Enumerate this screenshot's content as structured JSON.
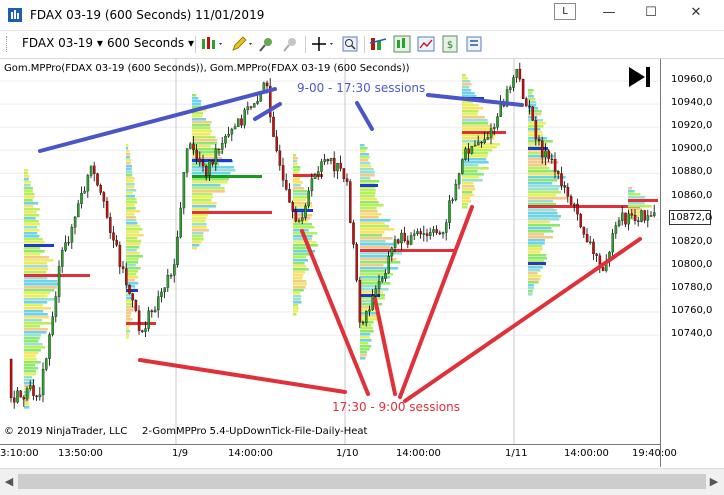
{
  "window": {
    "title": "FDAX 03-19 (600 Seconds)  11/01/2019",
    "link_label": "L"
  },
  "toolbar": {
    "instrument": "FDAX 03-19",
    "interval": "600 Seconds"
  },
  "chart": {
    "indicator_label": "Gom.MPPro(FDAX 03-19 (600 Seconds)), Gom.MPPro(FDAX 03-19 (600 Seconds))",
    "copyright": "© 2019 NinjaTrader, LLC",
    "script_label": "2-GomMPPro 5.4-UpDownTick-File-Daily-Heat",
    "annotation_blue": "9-00 - 17:30 sessions",
    "annotation_red": "17:30 - 9:00 sessions",
    "price_ticks": [
      "10960,0",
      "10940,0",
      "10920,0",
      "10900,0",
      "10880,0",
      "10860,0",
      "10840,0",
      "10820,0",
      "10800,0",
      "10780,0",
      "10760,0",
      "10740,0"
    ],
    "current_price": "10872,0",
    "time_ticks": [
      "3:10:00",
      "13:50:00",
      "1/9",
      "14:00:00",
      "1/10",
      "14:00:00",
      "1/11",
      "14:00:00",
      "19:40:00"
    ],
    "colors": {
      "blue_line": "#4a55c8",
      "red_line": "#e0303a",
      "up_candle": "#2ea02e",
      "down_candle": "#c01010"
    }
  },
  "chart_data": {
    "type": "candlestick",
    "instrument": "FDAX 03-19",
    "ylim": [
      10730,
      10975
    ]
  }
}
